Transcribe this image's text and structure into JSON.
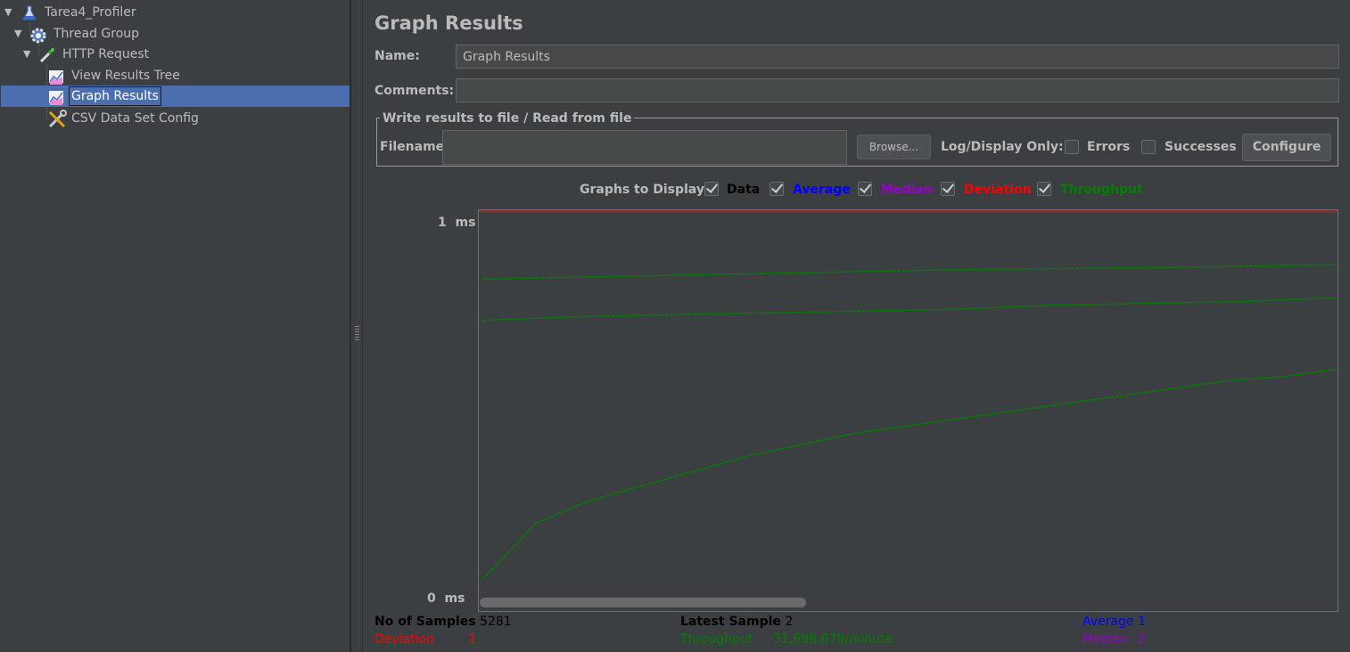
{
  "tree": {
    "items": [
      {
        "label": "Tarea4_Profiler",
        "icon": "test-plan-icon"
      },
      {
        "label": "Thread Group",
        "icon": "gear-icon"
      },
      {
        "label": "HTTP Request",
        "icon": "pipette-icon"
      },
      {
        "label": "View Results Tree",
        "icon": "graph-listener-icon"
      },
      {
        "label": "Graph Results",
        "icon": "graph-listener-icon"
      },
      {
        "label": "CSV Data Set Config",
        "icon": "tools-icon"
      }
    ],
    "selected": "Graph Results"
  },
  "panel": {
    "title": "Graph Results",
    "name_label": "Name:",
    "name_value": "Graph Results",
    "comments_label": "Comments:",
    "comments_value": "",
    "file_section": "Write results to file / Read from file",
    "filename_label": "Filename",
    "filename_value": "",
    "browse_label": "Browse...",
    "log_display_label": "Log/Display Only:",
    "errors_label": "Errors",
    "successes_label": "Successes",
    "configure_label": "Configure"
  },
  "graphs": {
    "label": "Graphs to Display",
    "options": [
      {
        "label": "Data",
        "checked": true,
        "color": "#000000"
      },
      {
        "label": "Average",
        "checked": true,
        "color": "#0000ff"
      },
      {
        "label": "Median",
        "checked": true,
        "color": "#9900cc"
      },
      {
        "label": "Deviation",
        "checked": true,
        "color": "#ff0000"
      },
      {
        "label": "Throughput",
        "checked": true,
        "color": "#008000"
      }
    ]
  },
  "chart_data": {
    "type": "line",
    "y_top_label": "1",
    "y_bottom_label": "0",
    "y_unit": "ms",
    "series": [
      {
        "name": "Throughput",
        "color": "#008000",
        "values": [
          0.05,
          0.2,
          0.26,
          0.3,
          0.34,
          0.38,
          0.41,
          0.44,
          0.46,
          0.48,
          0.5,
          0.52,
          0.54,
          0.56,
          0.58,
          0.59,
          0.61
        ]
      },
      {
        "color": "#008000",
        "values": [
          0.74,
          0.75,
          0.755,
          0.76,
          0.765,
          0.77,
          0.78,
          0.785,
          0.79,
          0.8
        ]
      },
      {
        "color": "#008000",
        "values": [
          0.85,
          0.855,
          0.86,
          0.865,
          0.87,
          0.875,
          0.878,
          0.88,
          0.884,
          0.888
        ]
      }
    ],
    "deviation_line": 1.03
  },
  "stats": {
    "samples_label": "No of Samples",
    "samples_value": "5281",
    "latest_label": "Latest Sample",
    "latest_value": "2",
    "average_label": "Average",
    "average_value": "1",
    "deviation_label": "Deviation",
    "deviation_value": "1",
    "throughput_label": "Throughput",
    "throughput_value": "31,698.679/minute",
    "median_label": "Median",
    "median_value": "2"
  },
  "colors": {
    "average": "#0000ff",
    "median": "#9900cc",
    "deviation": "#ff0000",
    "throughput": "#008000",
    "selection": "#4b6eaf"
  }
}
